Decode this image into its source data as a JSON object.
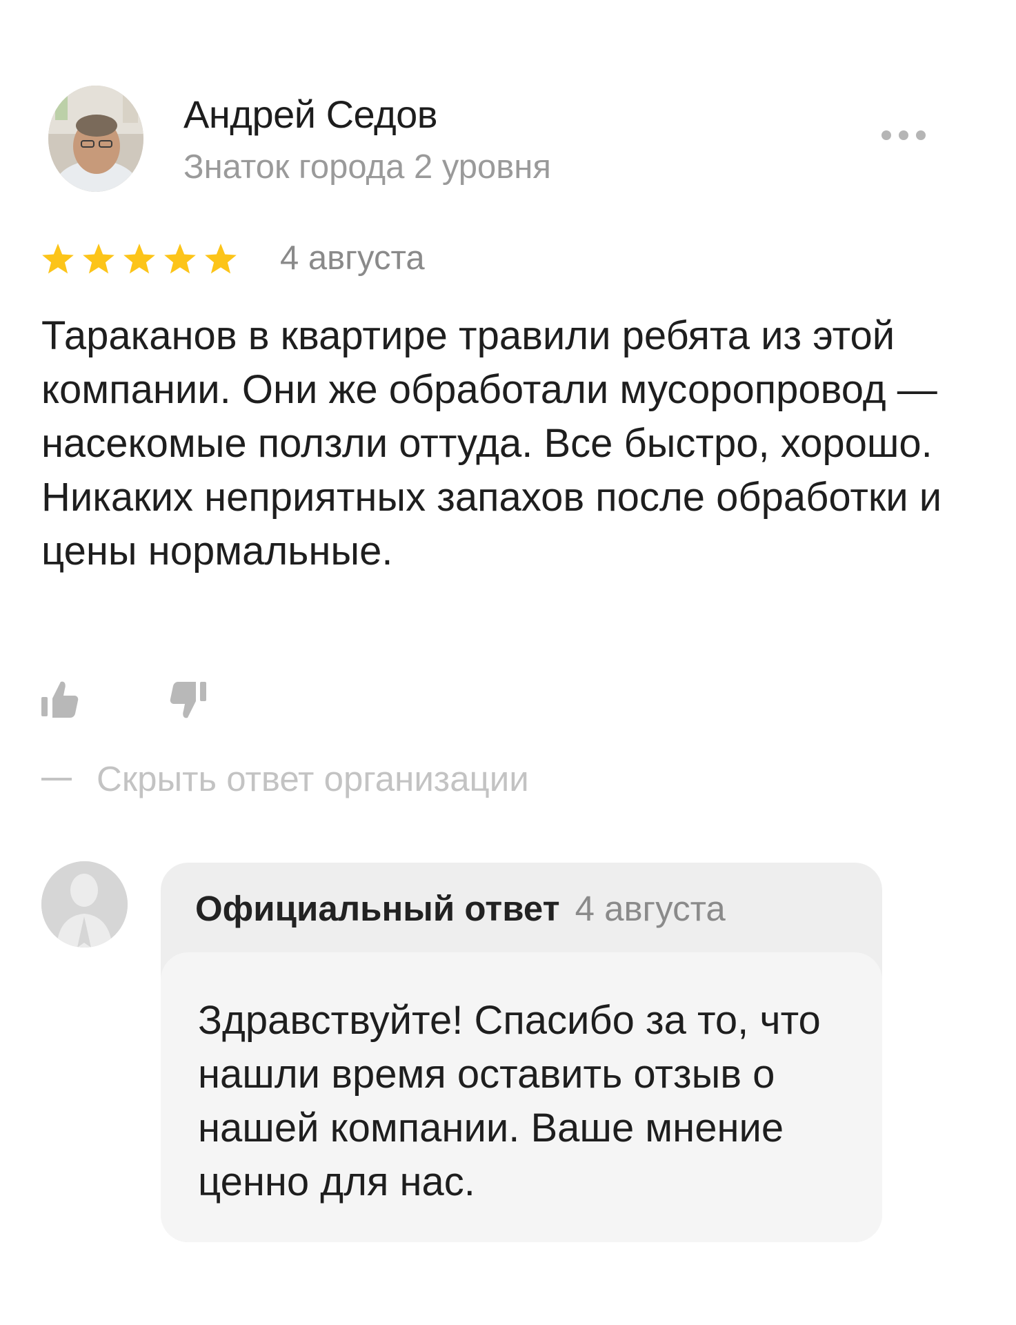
{
  "review": {
    "author": {
      "name": "Андрей Седов",
      "level": "Знаток города 2 уровня"
    },
    "rating": 5,
    "rating_max": 5,
    "date": "4 августа",
    "text": "Тараканов в квартире травили ребята из этой компании. Они же обработали мусоропровод — насекомые ползли оттуда. Все быстро, хорошо. Никаких неприятных запахов после обработки и цены нормальные.",
    "actions": {
      "like_icon": "thumbs-up-icon",
      "dislike_icon": "thumbs-down-icon",
      "more_icon": "more-dots-icon"
    },
    "toggle_reply_label": "Скрыть ответ организации"
  },
  "official_reply": {
    "label": "Официальный ответ",
    "date": "4 августа",
    "text": "Здравствуйте! Спасибо за то, что нашли время оставить отзыв о нашей компании. Ваше мнение ценно для нас."
  },
  "colors": {
    "star": "#fcc419",
    "muted_text": "#9a9a9a",
    "card_header_bg": "#eeeeee",
    "card_body_bg": "#f5f5f5"
  }
}
